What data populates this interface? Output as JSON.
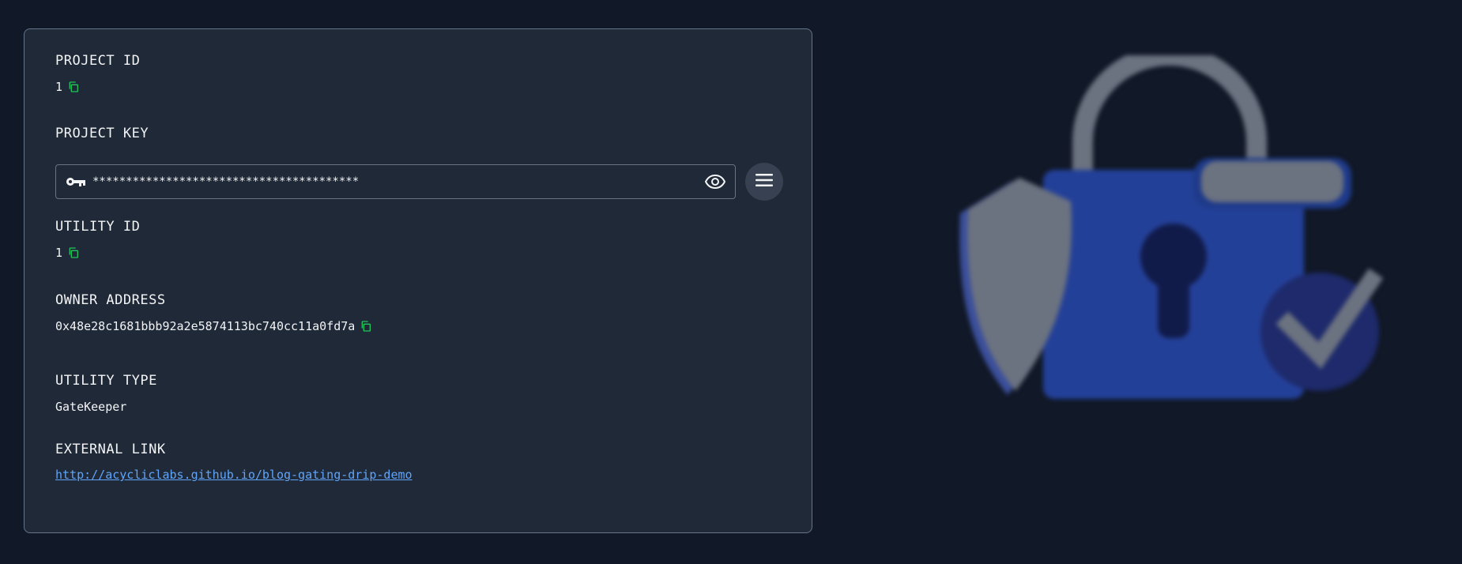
{
  "details": {
    "project_id": {
      "label": "PROJECT ID",
      "value": "1"
    },
    "project_key": {
      "label": "PROJECT KEY",
      "masked_value": "****************************************"
    },
    "utility_id": {
      "label": "UTILITY ID",
      "value": "1"
    },
    "owner_address": {
      "label": "OWNER ADDRESS",
      "value": "0x48e28c1681bbb92a2e5874113bc740cc11a0fd7a"
    },
    "utility_type": {
      "label": "UTILITY TYPE",
      "value": "GateKeeper"
    },
    "external_link": {
      "label": "EXTERNAL LINK",
      "value": "http://acycliclabs.github.io/blog-gating-drip-demo"
    }
  },
  "colors": {
    "background": "#111827",
    "card": "#1f2937",
    "copy_icon": "#22c55e",
    "link": "#60a5fa",
    "illustration_lock": "#1e3a8a"
  },
  "icons": [
    "copy-icon",
    "key-icon",
    "eye-icon",
    "menu-icon"
  ]
}
